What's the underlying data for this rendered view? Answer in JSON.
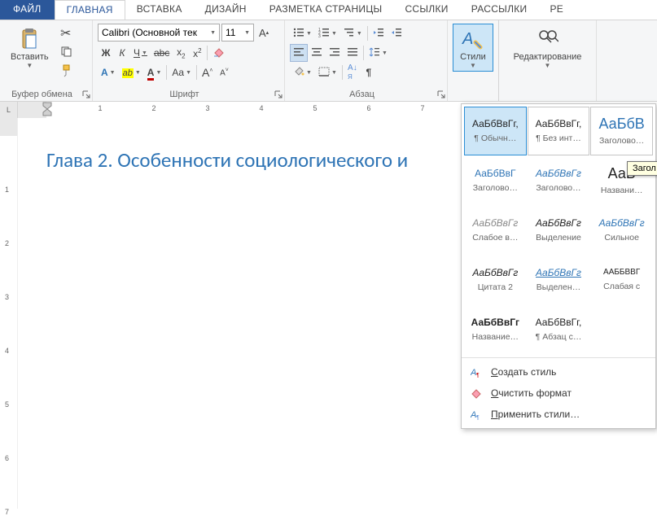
{
  "tabs": {
    "file": "ФАЙЛ",
    "home": "ГЛАВНАЯ",
    "insert": "ВСТАВКА",
    "design": "ДИЗАЙН",
    "layout": "РАЗМЕТКА СТРАНИЦЫ",
    "references": "ССЫЛКИ",
    "mailings": "РАССЫЛКИ",
    "review": "РЕ"
  },
  "groups": {
    "clipboard": {
      "label": "Буфер обмена",
      "paste": "Вставить"
    },
    "font": {
      "label": "Шрифт",
      "name": "Calibri (Основной тек",
      "size": "11",
      "bold": "Ж",
      "italic": "К",
      "underline": "Ч",
      "strike": "abc",
      "sub": "x₂",
      "sup": "x²"
    },
    "paragraph": {
      "label": "Абзац"
    },
    "styles": {
      "label": "Стили",
      "button": "Стили"
    },
    "editing": {
      "label": "Редактирование"
    }
  },
  "ruler": {
    "corner": "L"
  },
  "document": {
    "heading": "Глава 2. Особенности социологического и"
  },
  "styles_gallery": {
    "rows": [
      [
        {
          "sample": "АаБбВвГг,",
          "name": "¶ Обычн…",
          "sel": true
        },
        {
          "sample": "АаБбВвГг,",
          "name": "¶ Без инт…"
        },
        {
          "sample": "АаБбВ",
          "name": "Заголово…",
          "big": true,
          "color": "#2e74b5"
        }
      ],
      [
        {
          "sample": "АаБбВвГ",
          "name": "Заголово…",
          "color": "#2e74b5"
        },
        {
          "sample": "АаБбВвГг",
          "name": "Заголово…",
          "italic": true,
          "color": "#2e74b5"
        },
        {
          "sample": "АаБ",
          "name": "Названи…",
          "big": true
        }
      ],
      [
        {
          "sample": "АаБбВвГг",
          "name": "Слабое в…",
          "italic": true,
          "color": "#888"
        },
        {
          "sample": "АаБбВвГг",
          "name": "Выделение",
          "italic": true
        },
        {
          "sample": "АаБбВвГг",
          "name": "Сильное",
          "italic": true,
          "color": "#2e74b5"
        }
      ],
      [
        {
          "sample": "АаБбВвГг",
          "name": "Цитата 2",
          "italic": true
        },
        {
          "sample": "АаБбВвГг",
          "name": "Выделен…",
          "italic": true,
          "underline": true,
          "color": "#2e74b5"
        },
        {
          "sample": "ААББВВГ",
          "name": "Слабая с",
          "small": true
        }
      ],
      [
        {
          "sample": "АаБбВвГг",
          "name": "Название…",
          "bold": true
        },
        {
          "sample": "АаБбВвГг,",
          "name": "¶ Абзац с…"
        },
        {
          "empty": true
        }
      ]
    ],
    "menu": {
      "create": "Создать стиль",
      "clear": "Очистить формат",
      "apply": "Применить стили…"
    }
  },
  "tooltip": "Загол"
}
